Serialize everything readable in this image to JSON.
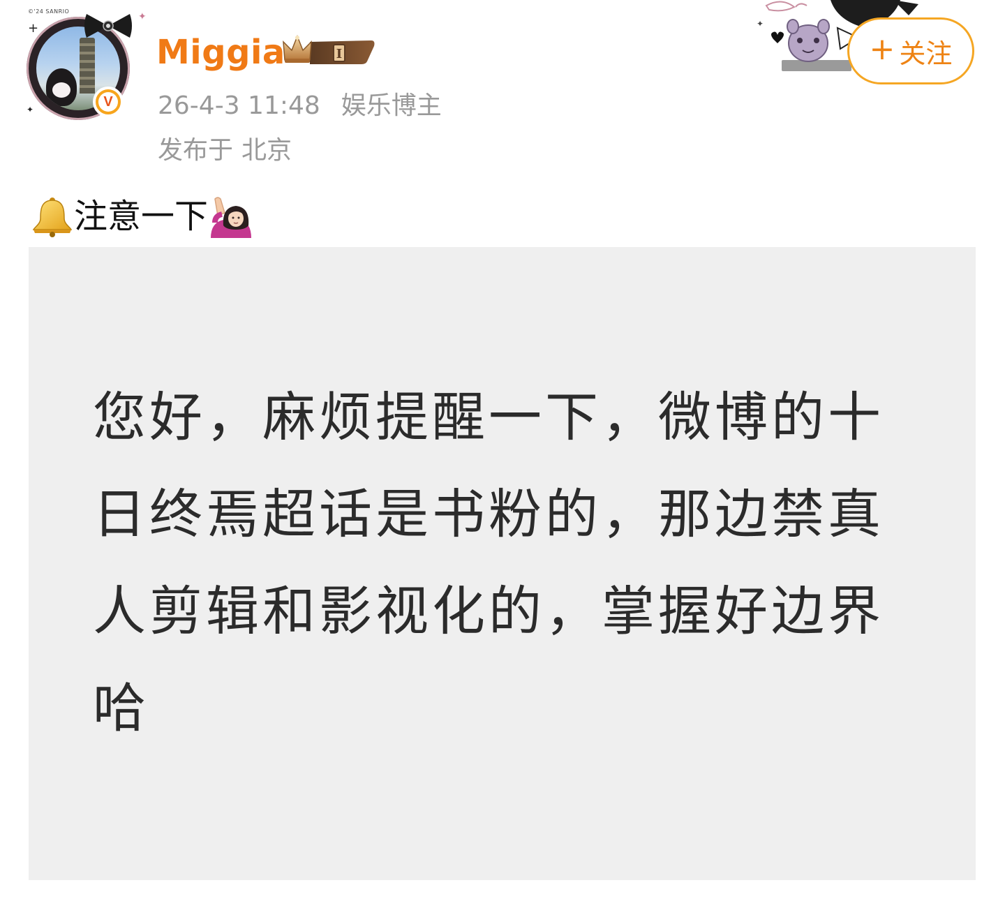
{
  "user": {
    "name": "Miggia",
    "avatar_watermark": "©'24 SANRIO",
    "verified_symbol": "V",
    "level_badge": "I"
  },
  "post_meta": {
    "timestamp": "26-4-3 11:48",
    "role": "娱乐博主",
    "location_prefix": "发布于",
    "location": "北京"
  },
  "follow_button": {
    "plus": "+",
    "label": "关注"
  },
  "post": {
    "text": "注意一下",
    "leading_emoji": "bell-icon",
    "trailing_emoji": "raising-hand-icon"
  },
  "image": {
    "lines": [
      "您好，麻烦提醒一下，微博的十",
      "日终焉超话是书粉的，那边禁真",
      "人剪辑和影视化的，掌握好边界",
      "哈"
    ]
  },
  "colors": {
    "username": "#f07a16",
    "follow_border": "#f5a623",
    "follow_text": "#ee8314",
    "meta_text": "#999999",
    "image_bg": "#efefef"
  }
}
